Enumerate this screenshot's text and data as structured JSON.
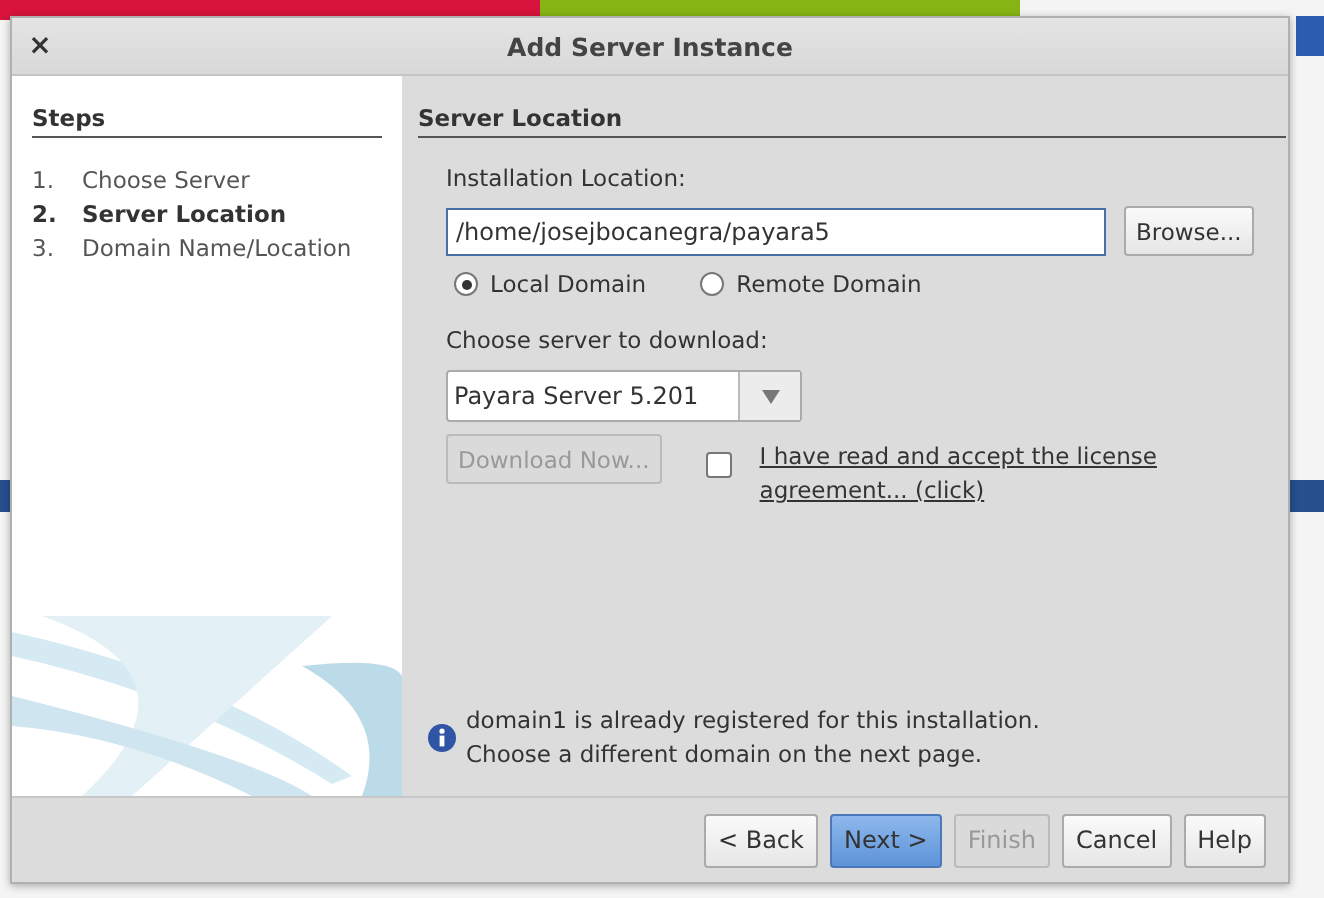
{
  "window": {
    "title": "Add Server Instance",
    "close": "×"
  },
  "steps": {
    "title": "Steps",
    "items": [
      {
        "number": "1.",
        "label": "Choose Server",
        "selected": false
      },
      {
        "number": "2.",
        "label": "Server Location",
        "selected": true
      },
      {
        "number": "3.",
        "label": "Domain Name/Location",
        "selected": false
      }
    ]
  },
  "panel": {
    "title": "Server Location",
    "location_label": "Installation Location:",
    "location_value": "/home/josejbocanegra/payara5",
    "browse": "Browse...",
    "radios": [
      {
        "label": "Local Domain",
        "selected": true
      },
      {
        "label": "Remote Domain",
        "selected": false
      }
    ],
    "server_label": "Choose server to download:",
    "server_value": "Payara Server 5.201",
    "download": {
      "label": "Download Now...",
      "disabled": true
    },
    "license": {
      "checked": false,
      "text": "I have read and accept the license agreement... (click)"
    },
    "info": [
      "domain1 is already registered for this installation.",
      "Choose a different domain on the next page."
    ]
  },
  "buttons": [
    {
      "label": "< Back",
      "default": false,
      "disabled": false
    },
    {
      "label": "Next >",
      "default": true,
      "disabled": false
    },
    {
      "label": "Finish",
      "default": false,
      "disabled": true
    },
    {
      "label": "Cancel",
      "default": false,
      "disabled": false
    },
    {
      "label": "Help",
      "default": false,
      "disabled": false
    }
  ]
}
